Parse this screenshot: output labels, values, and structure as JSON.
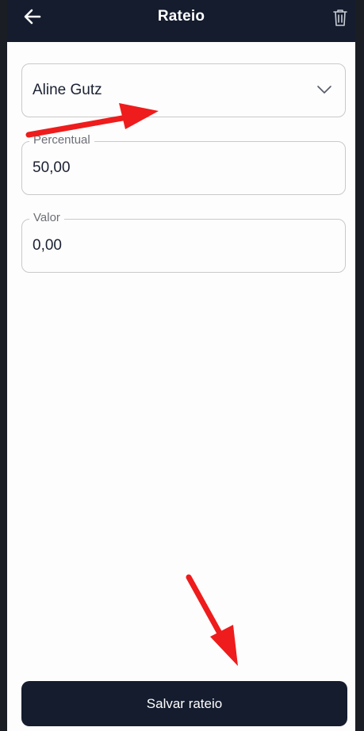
{
  "header": {
    "title": "Rateio",
    "back_icon": "arrow-left-icon",
    "delete_icon": "trash-icon"
  },
  "form": {
    "person_select": {
      "value": "Aline Gutz",
      "icon": "chevron-down-icon"
    },
    "percentual": {
      "label": "Percentual",
      "value": "50,00"
    },
    "valor": {
      "label": "Valor",
      "value": "0,00"
    }
  },
  "actions": {
    "save_label": "Salvar rateio"
  },
  "colors": {
    "header_bg": "#141c2e",
    "annotation_arrow": "#ee1c1c"
  }
}
